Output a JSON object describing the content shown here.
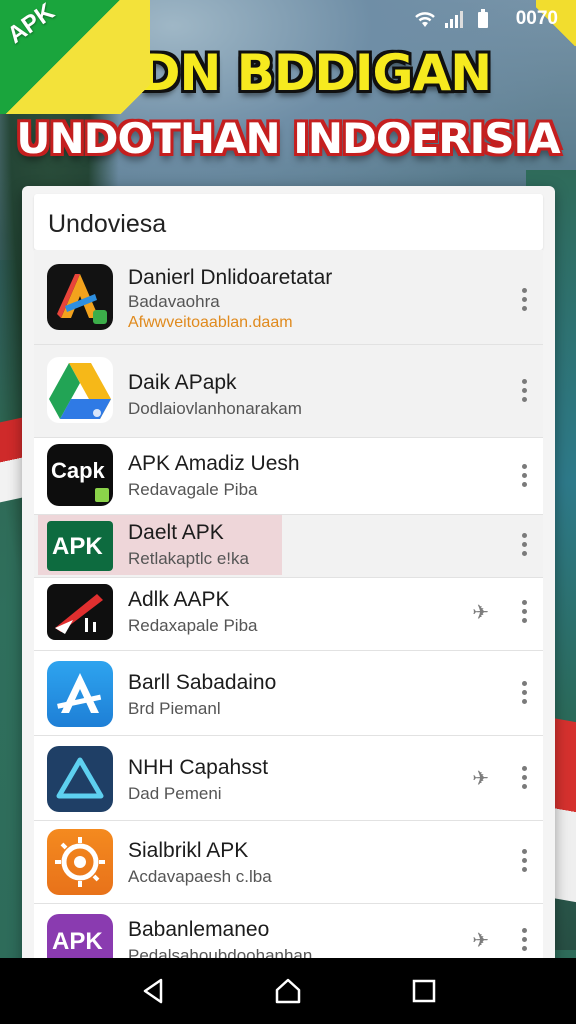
{
  "status_bar": {
    "time": "0070",
    "icons": [
      "wifi-icon",
      "signal-icon",
      "battery-icon"
    ]
  },
  "ribbon": {
    "text": "APK"
  },
  "headline": {
    "line1": "WDN BDDIGAN",
    "line2": "UNDOTHAN INDOERISIA"
  },
  "card": {
    "title": "Undoviesa",
    "apps": [
      {
        "name": "Danierl Dnlidoaretatar",
        "subtitle": "Badavaohra",
        "link": "Afwwveitoaablan.daam",
        "icon": "triangle-logo-icon"
      },
      {
        "name": "Daik APapk",
        "subtitle": "Dodlaiovlanhonarakam",
        "icon": "drive-logo-icon"
      },
      {
        "name": "APK Amadiz Uesh",
        "subtitle": "Redavagale Piba",
        "icon": "capk-logo-icon",
        "icon_text": "Capk"
      },
      {
        "name": "Daelt APK",
        "subtitle": "Retlakaptlc e!ka",
        "icon": "apk-green-icon",
        "icon_text": "APK"
      },
      {
        "name": "Adlk AAPK",
        "subtitle": "Redaxapale Piba",
        "icon": "red-arrow-logo-icon",
        "pinned": true
      },
      {
        "name": "Barll Sabadaino",
        "subtitle": "Brd Piemanl",
        "icon": "blue-a-logo-icon"
      },
      {
        "name": "NHH Capahsst",
        "subtitle": "Dad Pemeni",
        "icon": "navy-triangle-logo-icon",
        "pinned": true
      },
      {
        "name": "Sialbrikl APK",
        "subtitle": "Acdavapaesh c.lba",
        "icon": "orange-gear-logo-icon"
      },
      {
        "name": "Babanlemaneo",
        "subtitle": "Pedalsahoubdoohanhan",
        "icon": "purple-apk-icon",
        "icon_text": "APK",
        "pinned": true
      }
    ]
  },
  "nav": [
    "back-icon",
    "home-icon",
    "recents-icon"
  ],
  "colors": {
    "headline_yellow": "#f6ea1f",
    "headline_red": "#c41f1f",
    "link_orange": "#e08a1d",
    "card_bg": "#f4f4f4"
  }
}
